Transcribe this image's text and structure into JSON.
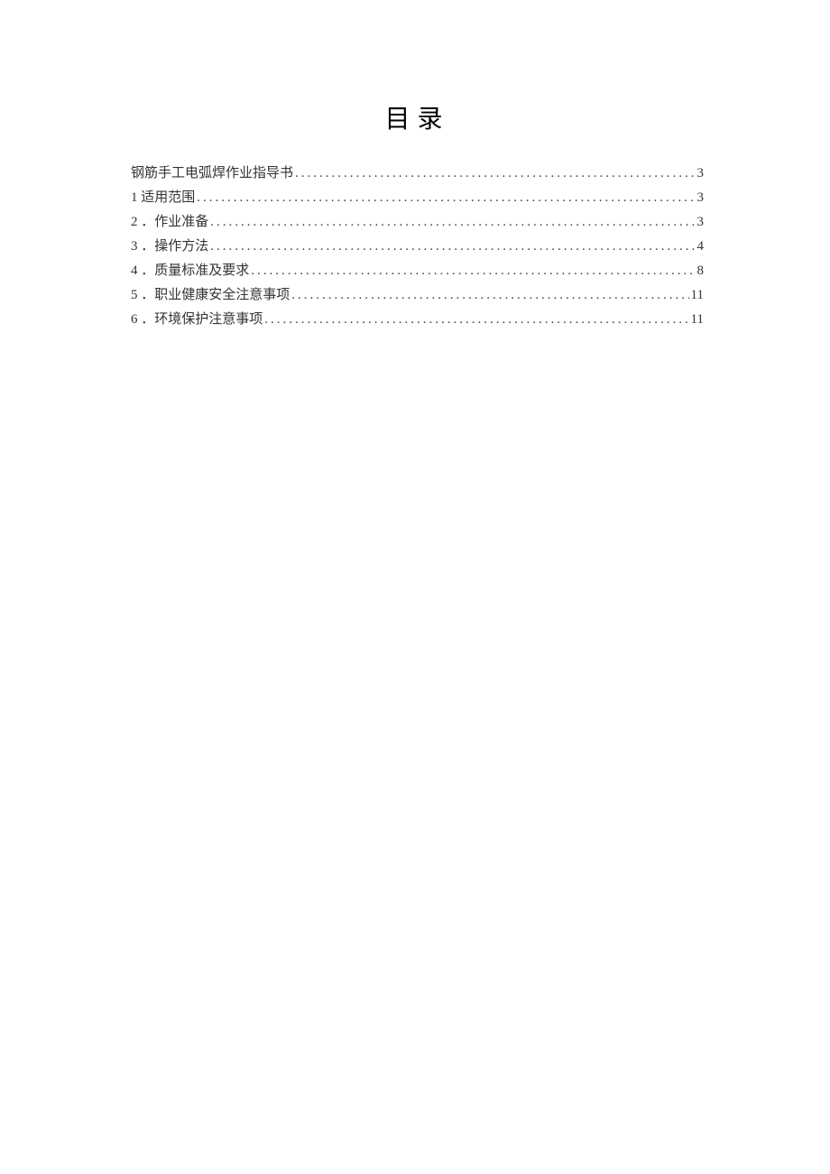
{
  "title": "目录",
  "toc": {
    "entries": [
      {
        "label": "钢筋手工电弧焊作业指导书",
        "page": "3"
      },
      {
        "label": "1 适用范围",
        "page": "3"
      },
      {
        "label": "2 ．作业准备",
        "page": "3"
      },
      {
        "label": "3 ．操作方法",
        "page": "4"
      },
      {
        "label": "4 ．质量标准及要求",
        "page": "8"
      },
      {
        "label": "5 ．职业健康安全注意事项",
        "page": "11"
      },
      {
        "label": "6 ．环境保护注意事项",
        "page": "11"
      }
    ]
  }
}
